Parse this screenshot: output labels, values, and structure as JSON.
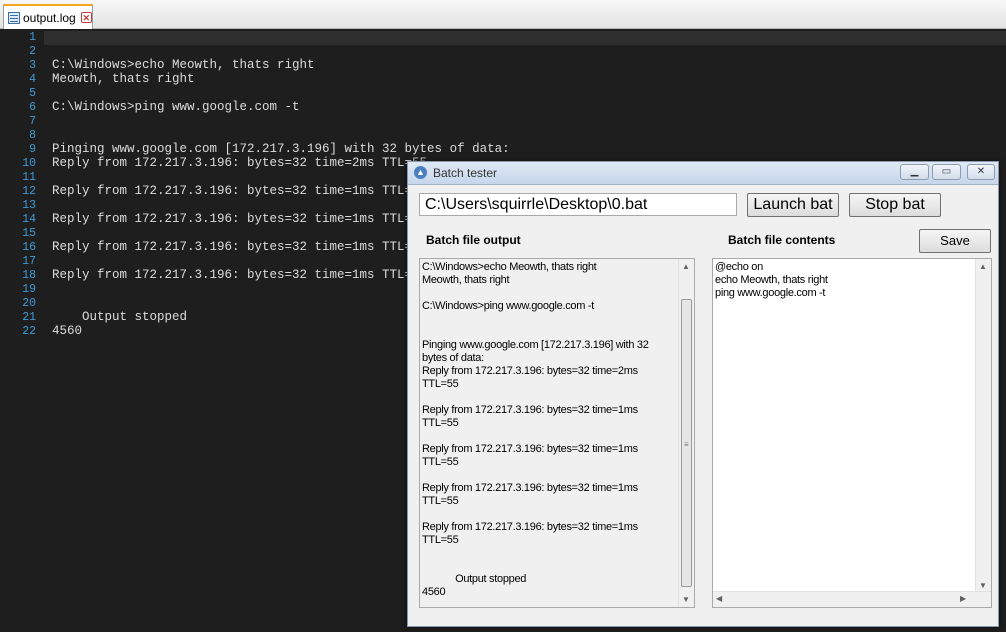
{
  "editor": {
    "tab_label": "output.log",
    "line_numbers": [
      "1",
      "2",
      "3",
      "4",
      "5",
      "6",
      "7",
      "8",
      "9",
      "10",
      "11",
      "12",
      "13",
      "14",
      "15",
      "16",
      "17",
      "18",
      "19",
      "20",
      "21",
      "22"
    ],
    "lines": [
      "",
      "",
      "C:\\Windows>echo Meowth, thats right",
      "Meowth, thats right",
      "",
      "C:\\Windows>ping www.google.com -t",
      "",
      "",
      "Pinging www.google.com [172.217.3.196] with 32 bytes of data:",
      "Reply from 172.217.3.196: bytes=32 time=2ms TTL=55",
      "",
      "Reply from 172.217.3.196: bytes=32 time=1ms TTL=55",
      "",
      "Reply from 172.217.3.196: bytes=32 time=1ms TTL=55",
      "",
      "Reply from 172.217.3.196: bytes=32 time=1ms TTL=55",
      "",
      "Reply from 172.217.3.196: bytes=32 time=1ms TTL=55",
      "",
      "",
      "    Output stopped",
      "4560"
    ],
    "colors": {
      "background": "#1e1e1e",
      "text": "#dcdcdc",
      "line_numbers": "#3f9bd6"
    }
  },
  "dialog": {
    "title": "Batch tester",
    "path_value": "C:\\Users\\squirrle\\Desktop\\0.bat",
    "launch_label": "Launch bat",
    "stop_label": "Stop bat",
    "output_label": "Batch file output",
    "contents_label": "Batch file contents",
    "save_label": "Save",
    "output_text": "C:\\Windows>echo Meowth, thats right\nMeowth, thats right\n\nC:\\Windows>ping www.google.com -t\n\n\nPinging www.google.com [172.217.3.196] with 32 bytes of data:\nReply from 172.217.3.196: bytes=32 time=2ms TTL=55\n\nReply from 172.217.3.196: bytes=32 time=1ms TTL=55\n\nReply from 172.217.3.196: bytes=32 time=1ms TTL=55\n\nReply from 172.217.3.196: bytes=32 time=1ms TTL=55\n\nReply from 172.217.3.196: bytes=32 time=1ms TTL=55\n\n\n            Output stopped\n4560",
    "contents_text": "@echo on\necho Meowth, thats right\nping www.google.com -t"
  }
}
